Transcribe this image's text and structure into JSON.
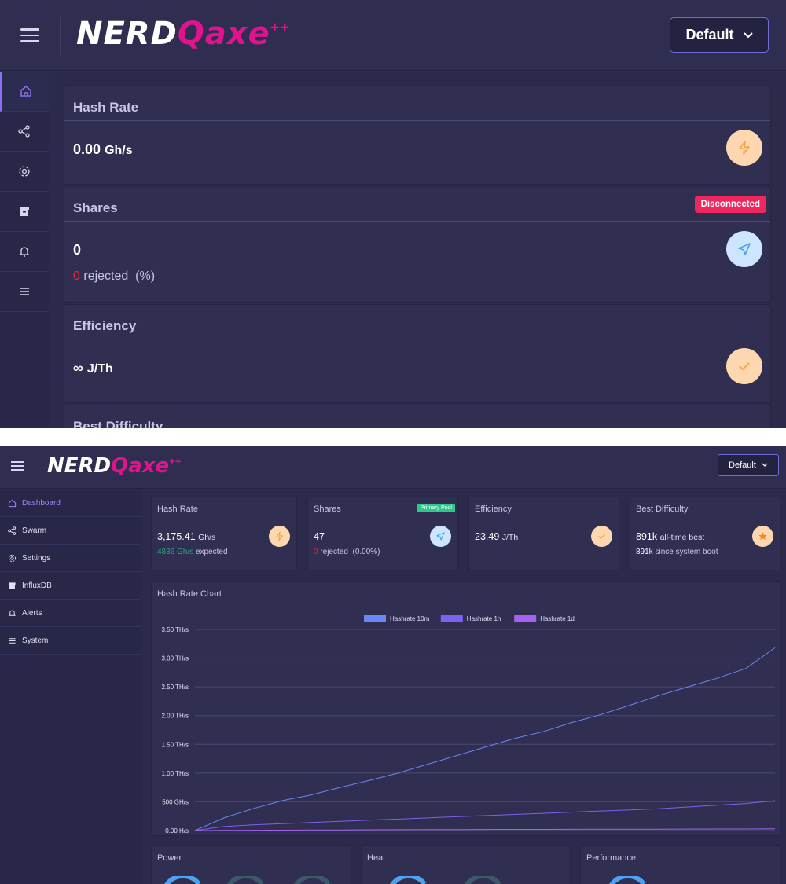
{
  "app": {
    "logo_main": "NERD",
    "logo_accent": "Qaxe",
    "logo_plus": "++",
    "profile_select": "Default"
  },
  "mobile": {
    "hash_rate": {
      "title": "Hash Rate",
      "value": "0.00",
      "unit": "Gh/s"
    },
    "shares": {
      "title": "Shares",
      "badge": "Disconnected",
      "value": "0",
      "rejected_count": "0",
      "rejected_label": "rejected",
      "rejected_pct": "(%)"
    },
    "efficiency": {
      "title": "Efficiency",
      "value": "∞",
      "unit": "J/Th"
    },
    "best_difficulty": {
      "title": "Best Difficulty"
    }
  },
  "desktop": {
    "sidebar": [
      {
        "label": "Dashboard",
        "icon": "home-icon"
      },
      {
        "label": "Swarm",
        "icon": "share-icon"
      },
      {
        "label": "Settings",
        "icon": "gear-icon"
      },
      {
        "label": "InfluxDB",
        "icon": "archive-icon"
      },
      {
        "label": "Alerts",
        "icon": "bell-icon"
      },
      {
        "label": "System",
        "icon": "menu-icon"
      }
    ],
    "hash_rate": {
      "title": "Hash Rate",
      "value": "3,175.41",
      "unit": "Gh/s",
      "expected_value": "4836 Gh/s",
      "expected_label": "expected"
    },
    "shares": {
      "title": "Shares",
      "badge": "Primary Pool",
      "value": "47",
      "rejected_count": "0",
      "rejected_label": "rejected",
      "rejected_pct": "(0.00%)"
    },
    "efficiency": {
      "title": "Efficiency",
      "value": "23.49",
      "unit": "J/Th"
    },
    "best_difficulty": {
      "title": "Best Difficulty",
      "value": "891k",
      "value_label": "all-time best",
      "boot_value": "891k",
      "boot_label": "since system boot"
    },
    "chart_title": "Hash Rate Chart",
    "bottom_cards": [
      "Power",
      "Heat",
      "Performance"
    ]
  },
  "colors": {
    "bg": "#2b2a4a",
    "card": "#302f52",
    "accent_pink": "#e0138c",
    "accent_purple": "#8b6ff0",
    "orange": "#f5a443",
    "blue": "#4ba3f2",
    "red": "#f0265e",
    "green": "#2cc98b"
  },
  "chart_data": {
    "type": "line",
    "title": "Hash Rate Chart",
    "xlabel": "",
    "ylabel": "",
    "ylim": [
      0,
      3.5
    ],
    "yticks": [
      "0.00 H/s",
      "500 GH/s",
      "1.00 TH/s",
      "1.50 TH/s",
      "2.00 TH/s",
      "2.50 TH/s",
      "3.00 TH/s",
      "3.50 TH/s"
    ],
    "legend_position": "top",
    "grid": true,
    "x": [
      0,
      1,
      2,
      3,
      4,
      5,
      6,
      7,
      8,
      9,
      10,
      11,
      12,
      13,
      14,
      15,
      16,
      17,
      18,
      19,
      20
    ],
    "series": [
      {
        "name": "Hashrate 10m",
        "color": "#6a86f5",
        "values": [
          0.0,
          0.22,
          0.38,
          0.52,
          0.62,
          0.75,
          0.87,
          1.0,
          1.15,
          1.3,
          1.45,
          1.6,
          1.72,
          1.88,
          2.02,
          2.18,
          2.35,
          2.5,
          2.65,
          2.82,
          3.18
        ]
      },
      {
        "name": "Hashrate 1h",
        "color": "#7b62f0",
        "values": [
          0.0,
          0.07,
          0.1,
          0.12,
          0.14,
          0.16,
          0.18,
          0.2,
          0.22,
          0.24,
          0.26,
          0.28,
          0.3,
          0.32,
          0.34,
          0.36,
          0.38,
          0.41,
          0.44,
          0.47,
          0.52
        ]
      },
      {
        "name": "Hashrate 1d",
        "color": "#a562f0",
        "values": [
          0.0,
          0.003,
          0.005,
          0.007,
          0.009,
          0.011,
          0.013,
          0.015,
          0.017,
          0.018,
          0.019,
          0.02,
          0.021,
          0.022,
          0.023,
          0.024,
          0.025,
          0.026,
          0.027,
          0.028,
          0.03
        ]
      }
    ]
  }
}
